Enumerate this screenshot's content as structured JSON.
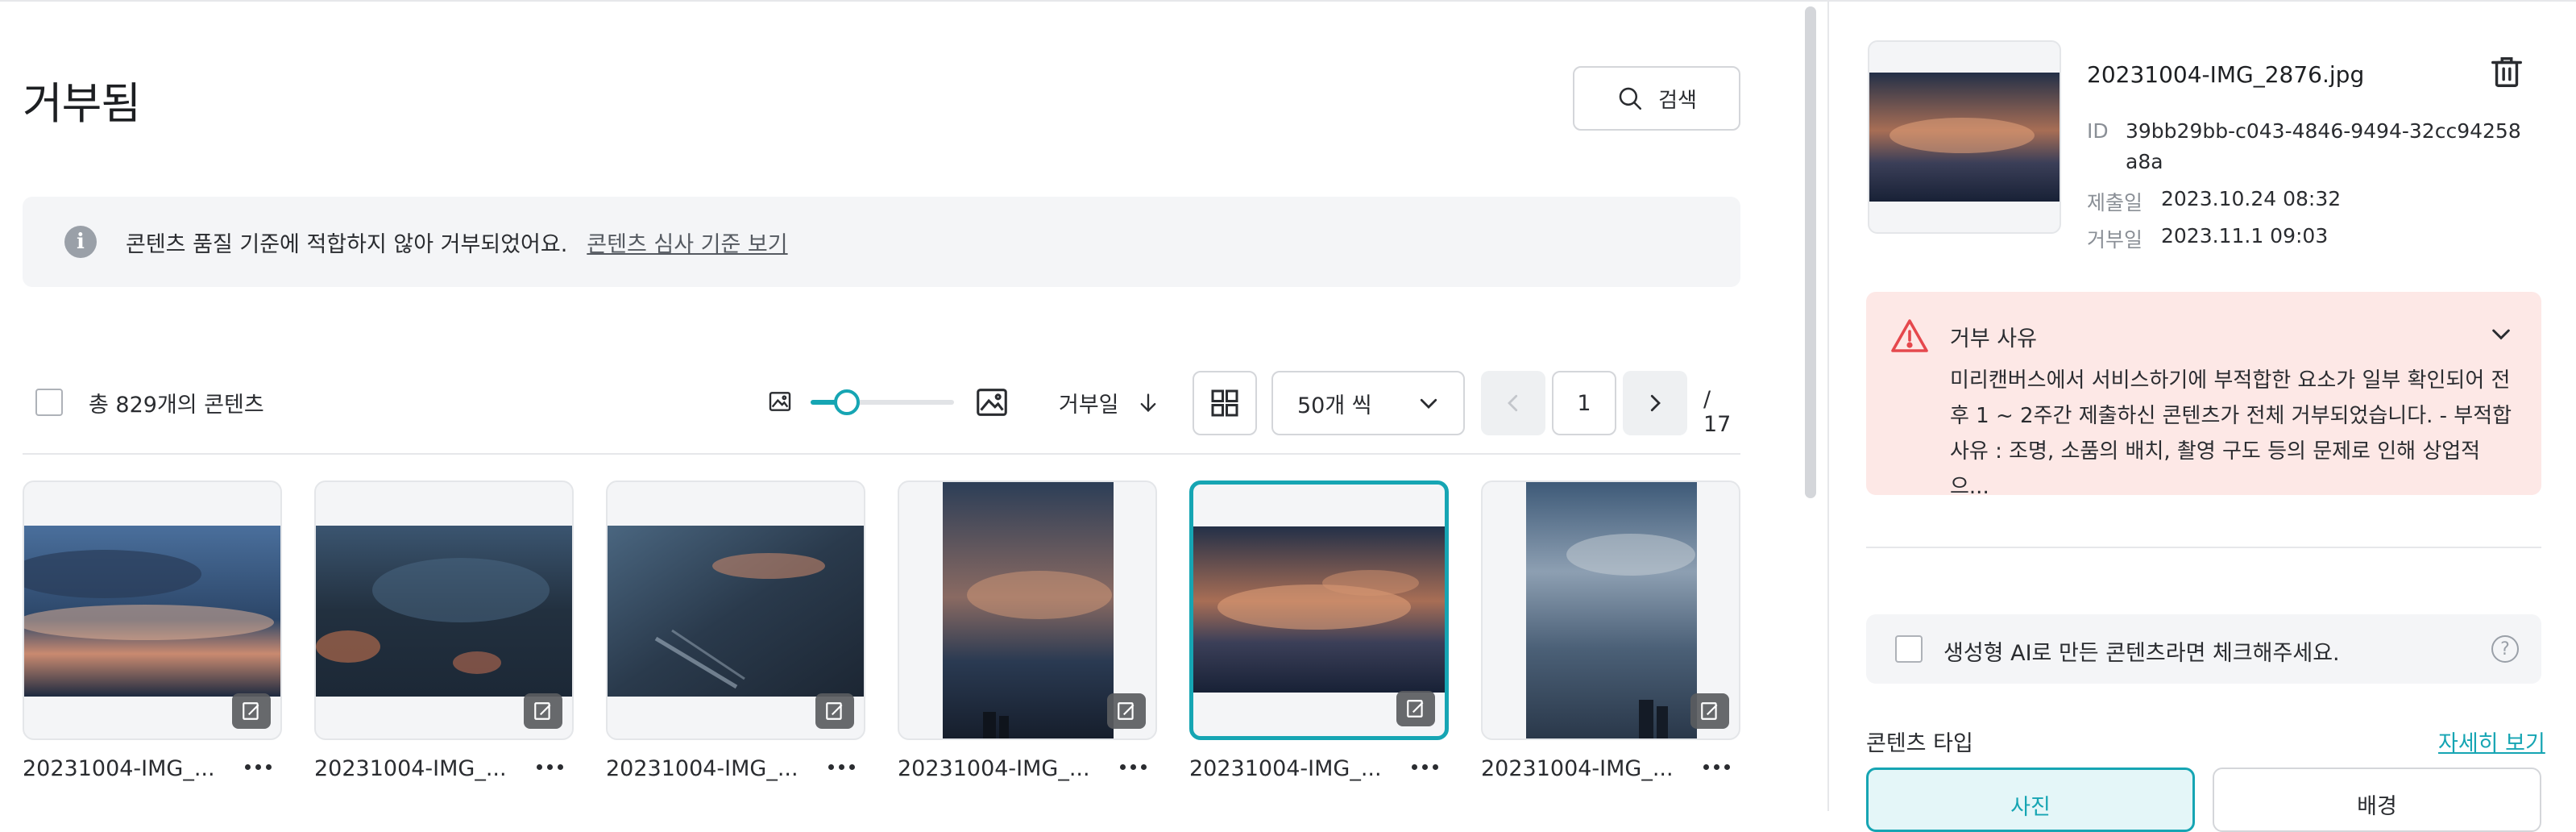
{
  "page": {
    "title": "거부됨"
  },
  "search": {
    "label": "검색"
  },
  "notice": {
    "text": "콘텐츠 품질 기준에 적합하지 않아 거부되었어요.",
    "link": "콘텐츠 심사 기준 보기"
  },
  "toolbar": {
    "total": "총 829개의 콘텐츠",
    "thumbnail_size_level": 0.25,
    "sort_label": "거부일",
    "per_page": "50개 씩",
    "current_page": "1",
    "total_pages": "/ 17"
  },
  "cards": [
    {
      "name": "20231004-IMG_...",
      "orientation": "landscape",
      "selected": false
    },
    {
      "name": "20231004-IMG_...",
      "orientation": "landscape",
      "selected": false
    },
    {
      "name": "20231004-IMG_...",
      "orientation": "landscape",
      "selected": false
    },
    {
      "name": "20231004-IMG_...",
      "orientation": "portrait",
      "selected": false
    },
    {
      "name": "20231004-IMG_...",
      "orientation": "landscape",
      "selected": true
    },
    {
      "name": "20231004-IMG_...",
      "orientation": "portrait",
      "selected": false
    }
  ],
  "detail": {
    "filename": "20231004-IMG_2876.jpg",
    "id_label": "ID",
    "id_value": "39bb29bb-c043-4846-9494-32cc94258a8a",
    "submitted_label": "제출일",
    "submitted_value": "2023.10.24 08:32",
    "rejected_label": "거부일",
    "rejected_value": "2023.11.1 09:03",
    "reason_title": "거부 사유",
    "reason_body": "미리캔버스에서 서비스하기에 부적합한 요소가 일부 확인되어 전후 1 ~ 2주간 제출하신 콘텐츠가 전체 거부되었습니다. - 부적합 사유 : 조명, 소품의 배치, 촬영 구도 등의 문제로 인해 상업적으...",
    "ai_checkbox_label": "생성형 AI로 만든 콘텐츠라면 체크해주세요.",
    "content_type_label": "콘텐츠 타입",
    "details_link": "자세히 보기",
    "type_options": [
      "사진",
      "배경"
    ]
  },
  "colors": {
    "accent": "#16a5b3",
    "reason_bg": "#fde8e6",
    "warn": "#e5484d"
  }
}
